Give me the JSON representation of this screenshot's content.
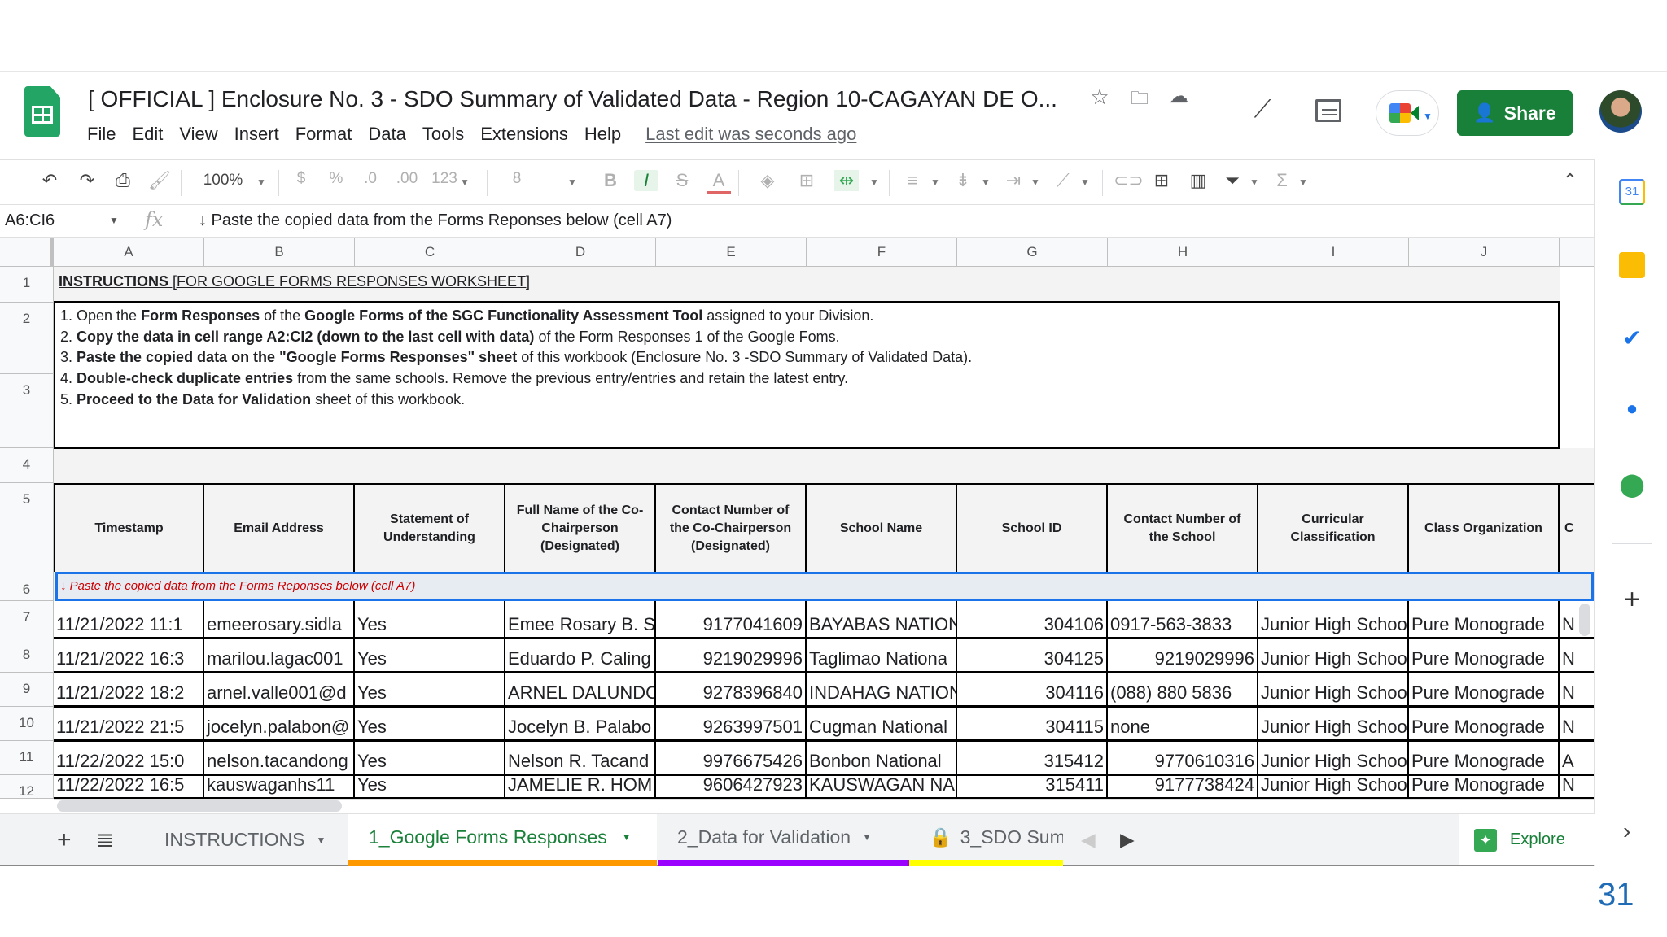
{
  "app": {
    "title": "[ OFFICIAL ] Enclosure No. 3 - SDO Summary of Validated Data - Region 10-CAGAYAN DE O...",
    "menu": [
      "File",
      "Edit",
      "View",
      "Insert",
      "Format",
      "Data",
      "Tools",
      "Extensions",
      "Help"
    ],
    "last_edit": "Last edit was seconds ago",
    "share_label": "Share"
  },
  "toolbar": {
    "zoom": "100%",
    "currency": "$",
    "percent": "%",
    "decimal_decrease": ".0",
    "decimal_increase": ".00",
    "format_more": "123",
    "font_size": "8",
    "bold": "B",
    "italic": "I",
    "strikethrough": "S",
    "text_color": "A",
    "sum": "Σ"
  },
  "formula_bar": {
    "cell_ref": "A6:CI6",
    "fx": "fx",
    "content": "↓ Paste the copied data from the Forms Reponses below (cell A7)"
  },
  "columns": [
    "A",
    "B",
    "C",
    "D",
    "E",
    "F",
    "G",
    "H",
    "I",
    "J"
  ],
  "row_numbers": [
    "1",
    "2",
    "3",
    "4",
    "5",
    "6",
    "7",
    "8",
    "9",
    "10",
    "11",
    "12"
  ],
  "instructions": {
    "title_bold": "INSTRUCTIONS",
    "title_rest": " [FOR GOOGLE FORMS RESPONSES WORKSHEET]",
    "lines": [
      [
        {
          "t": "1. Open the "
        },
        {
          "t": "Form Responses",
          "b": true
        },
        {
          "t": " of the "
        },
        {
          "t": "Google Forms of the SGC Functionality Assessment Tool",
          "b": true
        },
        {
          "t": " assigned to your Division."
        }
      ],
      [
        {
          "t": "2. "
        },
        {
          "t": "Copy the data in cell range A2:CI2 (down to the last cell with data)",
          "b": true
        },
        {
          "t": " of the Form Responses 1 of the Google Foms."
        }
      ],
      [
        {
          "t": "3. "
        },
        {
          "t": "Paste the copied data on the \"Google Forms Responses\" sheet",
          "b": true
        },
        {
          "t": " of this workbook (Enclosure No. 3 -SDO Summary of Validated Data)."
        }
      ],
      [
        {
          "t": "4. "
        },
        {
          "t": "Double-check duplicate entries",
          "b": true
        },
        {
          "t": " from the same schools. Remove the previous entry/entries and retain the latest entry."
        }
      ],
      [
        {
          "t": "5. "
        },
        {
          "t": "Proceed to the Data for Validation",
          "b": true
        },
        {
          "t": " sheet of this workbook."
        }
      ]
    ]
  },
  "headers": [
    "Timestamp",
    "Email Address",
    "Statement of Understanding",
    "Full Name of the Co-Chairperson (Designated)",
    "Contact Number of the Co-Chairperson (Designated)",
    "School Name",
    "School ID",
    "Contact Number of the School",
    "Curricular Classification",
    "Class Organization",
    "C"
  ],
  "paste_note": "↓ Paste the copied data from the Forms Reponses below (cell A7)",
  "rows": [
    {
      "cells": [
        "11/21/2022 11:1",
        "emeerosary.sidla",
        "Yes",
        "Emee Rosary B. S",
        "9177041609",
        "BAYABAS NATION",
        "304106",
        "0917-563-3833",
        "Junior High Schoo",
        "Pure Monograde",
        "N"
      ]
    },
    {
      "cells": [
        "11/21/2022 16:3",
        "marilou.lagac001",
        "Yes",
        "Eduardo P. Caling",
        "9219029996",
        "Taglimao Nationa",
        "304125",
        "9219029996",
        "Junior High Schoo",
        "Pure Monograde",
        "N"
      ]
    },
    {
      "cells": [
        "11/21/2022 18:2",
        "arnel.valle001@d",
        "Yes",
        "ARNEL DALUNDO",
        "9278396840",
        "INDAHAG NATION",
        "304116",
        "(088) 880 5836",
        "Junior High Schoo",
        "Pure Monograde",
        "N"
      ]
    },
    {
      "cells": [
        "11/21/2022 21:5",
        "jocelyn.palabon@",
        "Yes",
        "Jocelyn B. Palabo",
        "9263997501",
        "Cugman National",
        "304115",
        "none",
        "Junior High Schoo",
        "Pure Monograde",
        "N"
      ]
    },
    {
      "cells": [
        "11/22/2022 15:0",
        "nelson.tacandong",
        "Yes",
        "Nelson R. Tacand",
        "9976675426",
        "Bonbon National",
        "315412",
        "9770610316",
        "Junior High Schoo",
        "Pure Monograde",
        "A"
      ]
    },
    {
      "cells": [
        "11/22/2022 16:5",
        "kauswaganhs11",
        "Yes",
        "JAMELIE R. HOMI",
        "9606427923",
        "KAUSWAGAN NA",
        "315411",
        "9177738424",
        "Junior High Schoo",
        "Pure Monograde",
        "N"
      ]
    }
  ],
  "tabs": [
    {
      "label": "INSTRUCTIONS",
      "color": ""
    },
    {
      "label": "1_Google Forms Responses",
      "color": "#ff9900",
      "active": true
    },
    {
      "label": "2_Data for Validation",
      "color": "#9900ff"
    },
    {
      "label": "3_SDO Sum",
      "color": "#ffff00",
      "locked": true
    }
  ],
  "explore_label": "Explore",
  "calendar_day": "31",
  "slide_number": "31",
  "colors": {
    "brand": "#188038",
    "selection": "#1a73e8",
    "note": "#cc0000"
  }
}
